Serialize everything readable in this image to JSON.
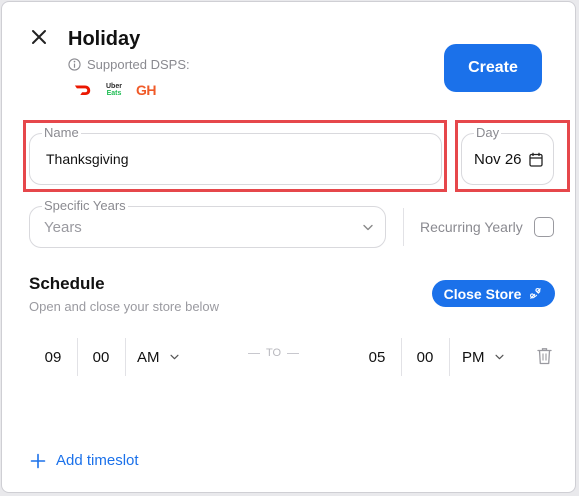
{
  "header": {
    "title": "Holiday",
    "supported_label": "Supported DSPS:",
    "logos": {
      "doordash": "doordash-logo",
      "ubereats_top": "Uber",
      "ubereats_bottom": "Eats",
      "grubhub": "GH"
    },
    "create_label": "Create"
  },
  "form": {
    "name_label": "Name",
    "name_value": "Thanksgiving",
    "day_label": "Day",
    "day_value": "Nov 26",
    "years_label": "Specific Years",
    "years_value": "Years",
    "recurring_label": "Recurring Yearly",
    "recurring_checked": false
  },
  "schedule": {
    "title": "Schedule",
    "subtitle": "Open and close your store below",
    "close_store_label": "Close Store",
    "slot": {
      "start_hour": "09",
      "start_min": "00",
      "start_ampm": "AM",
      "to_label": "TO",
      "end_hour": "05",
      "end_min": "00",
      "end_ampm": "PM"
    },
    "add_timeslot_label": "Add timeslot"
  },
  "colors": {
    "accent": "#1b71ea",
    "highlight": "#e6474b"
  }
}
